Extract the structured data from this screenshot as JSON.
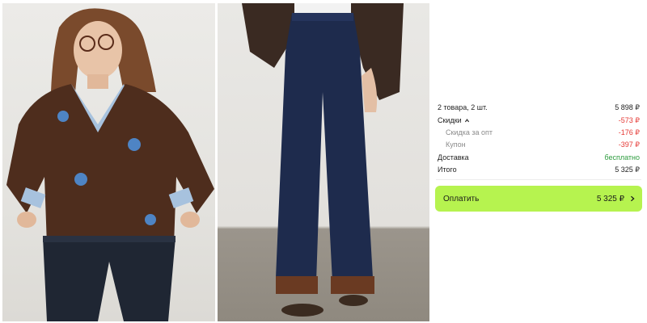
{
  "colors": {
    "accent_button": "#b6f34f",
    "discount_red": "#e53935",
    "free_green": "#2e9c3f",
    "muted_text": "#8a8a8a"
  },
  "products": [
    {
      "image": "brown-sweater-photo"
    },
    {
      "image": "wide-leg-jeans-photo"
    }
  ],
  "summary": {
    "items": {
      "label": "2 товара, 2 шт.",
      "value": "5 898 ₽"
    },
    "discounts": {
      "label": "Скидки",
      "value": "-573 ₽",
      "expanded": true
    },
    "wholesale": {
      "label": "Скидка за опт",
      "value": "-176 ₽"
    },
    "coupon": {
      "label": "Купон",
      "value": "-397 ₽"
    },
    "delivery": {
      "label": "Доставка",
      "value": "бесплатно"
    },
    "total": {
      "label": "Итого",
      "value": "5 325 ₽"
    }
  },
  "pay_button": {
    "label": "Оплатить",
    "amount": "5 325 ₽"
  }
}
